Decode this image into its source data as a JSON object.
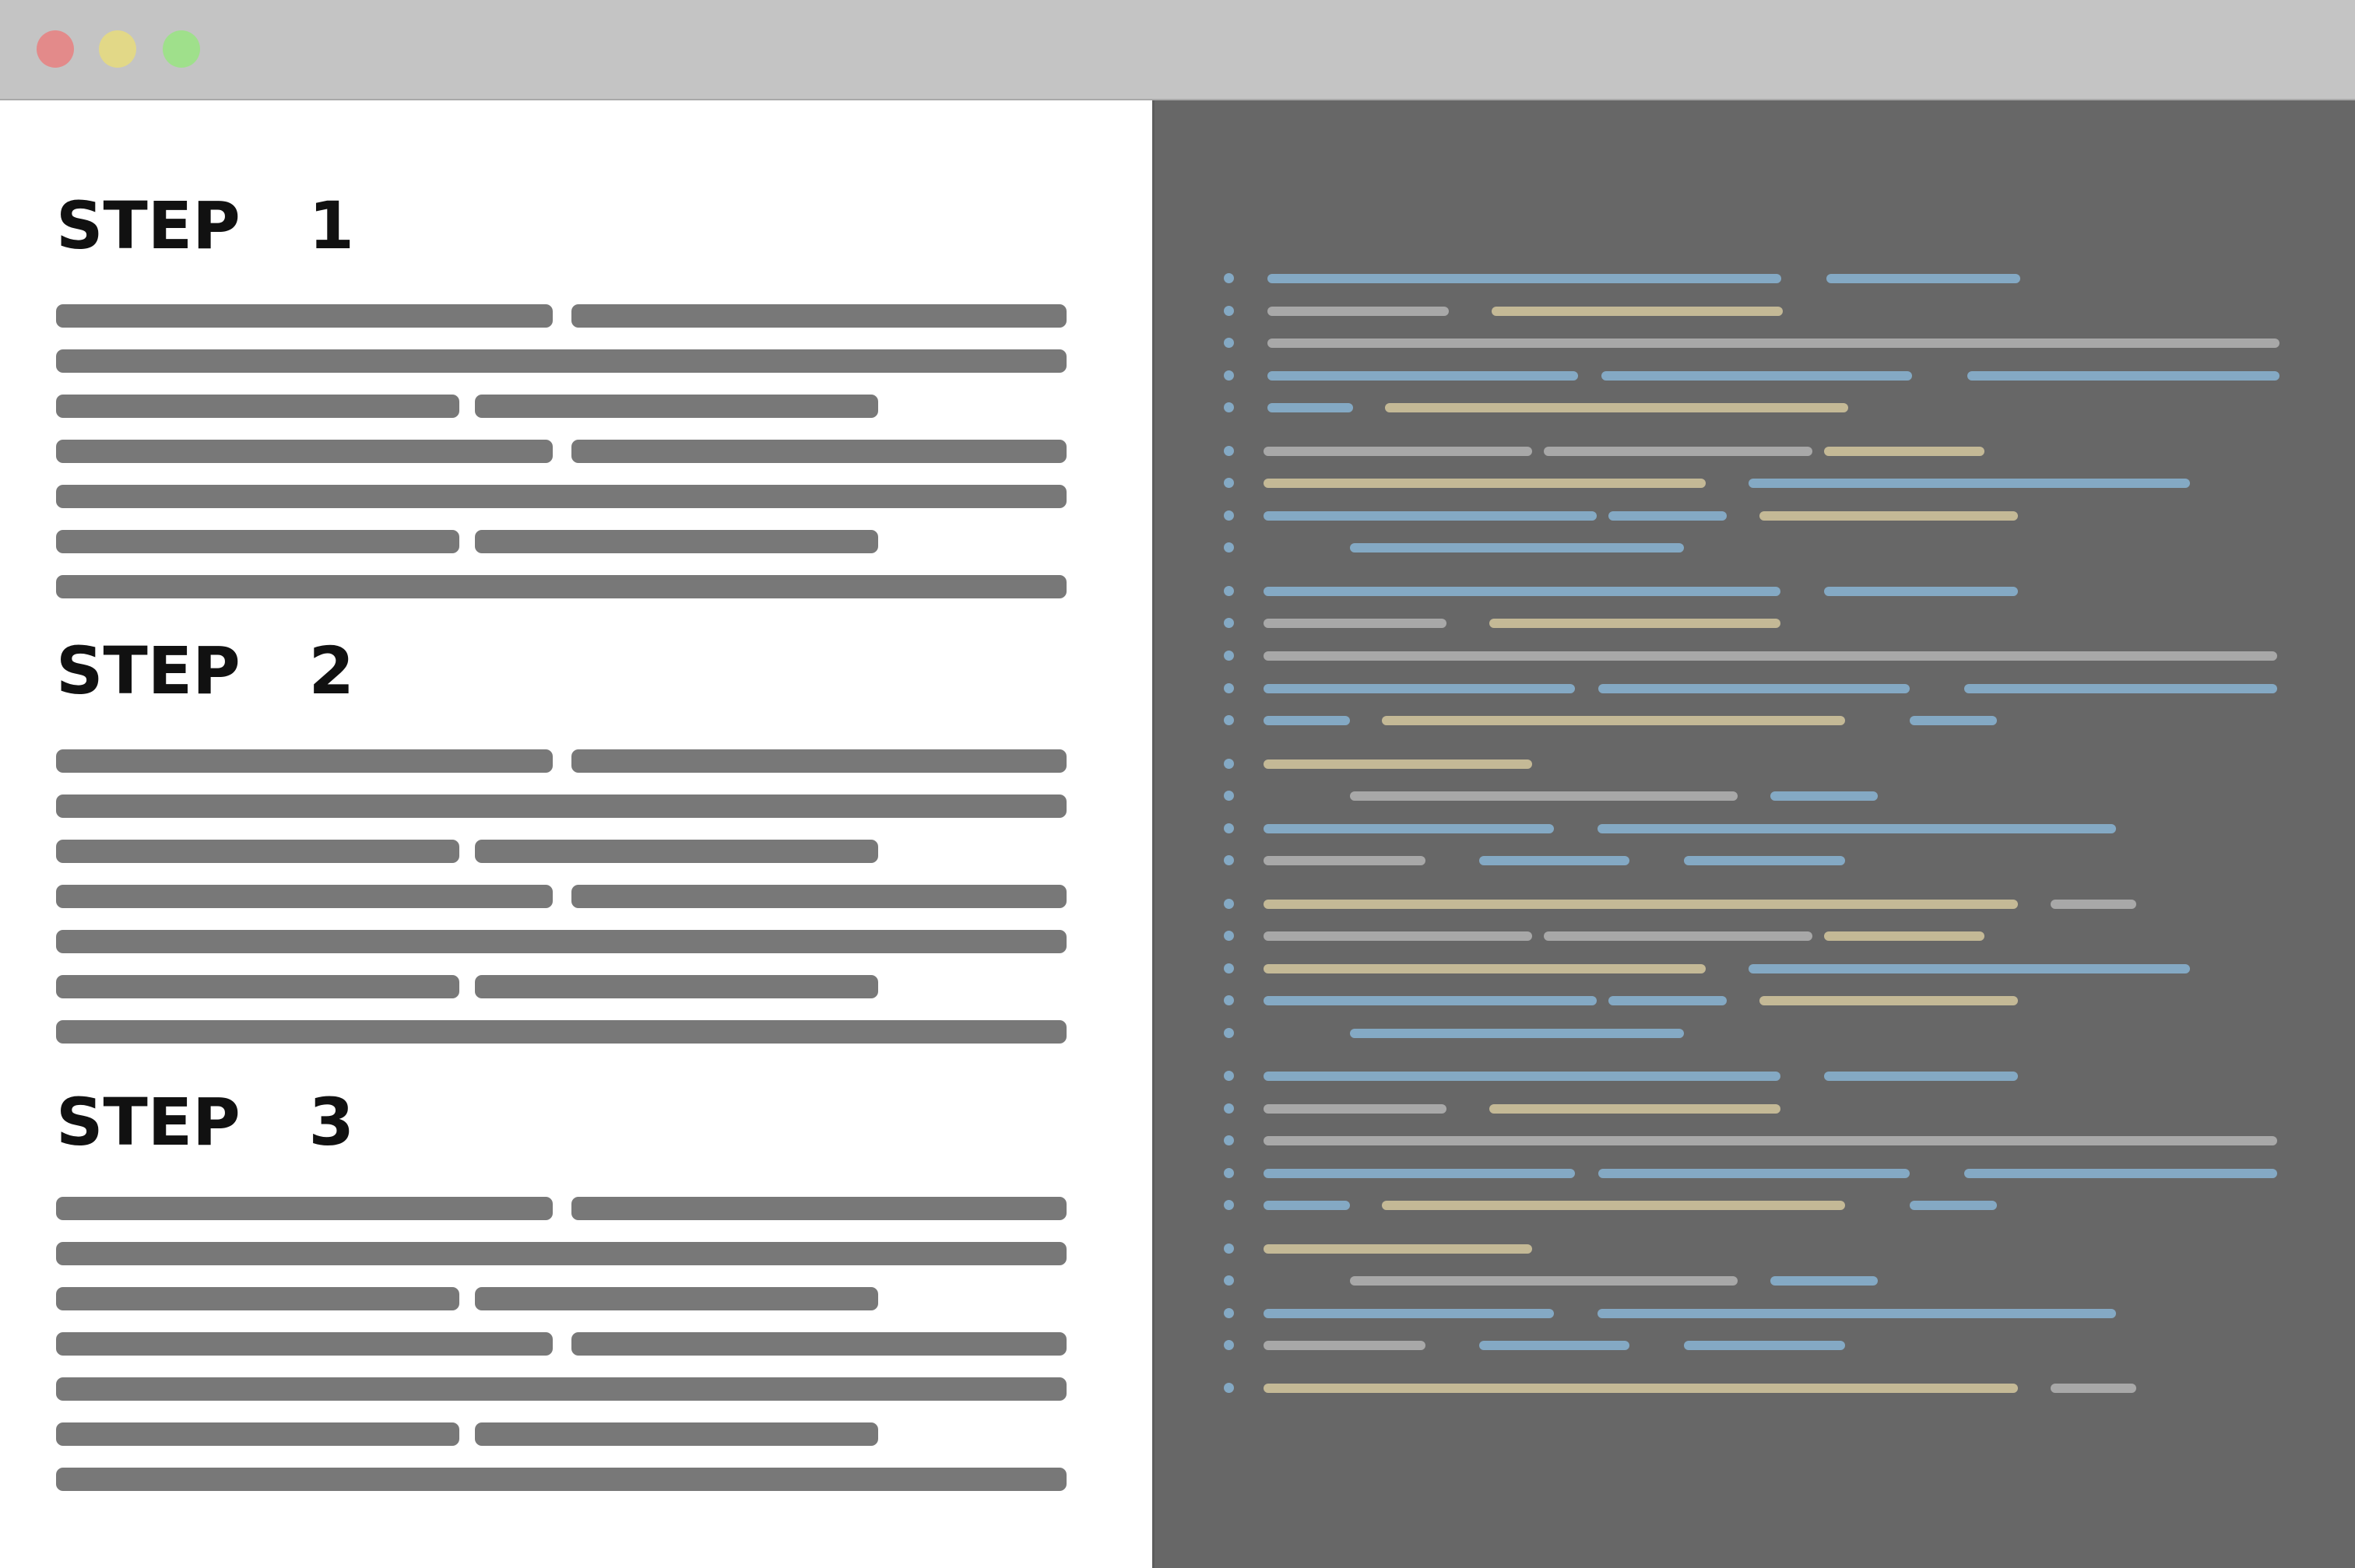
{
  "window": {
    "controls": [
      "close",
      "minimize",
      "maximize"
    ],
    "colors": {
      "close": "#e38a8a",
      "minimize": "#e2d887",
      "maximize": "#9fe08b",
      "titlebar": "#c4c4c4"
    }
  },
  "document": {
    "steps": [
      {
        "heading": "STEP   1"
      },
      {
        "heading": "STEP   2"
      },
      {
        "heading": "STEP   3"
      }
    ],
    "text_color": "#787878",
    "heading_color": "#111111"
  },
  "code_editor": {
    "background": "#676767",
    "token_colors": {
      "blue": "#84a9c4",
      "gray": "#a8a8a8",
      "tan": "#c4b996",
      "dot": "#84a9c4"
    }
  }
}
